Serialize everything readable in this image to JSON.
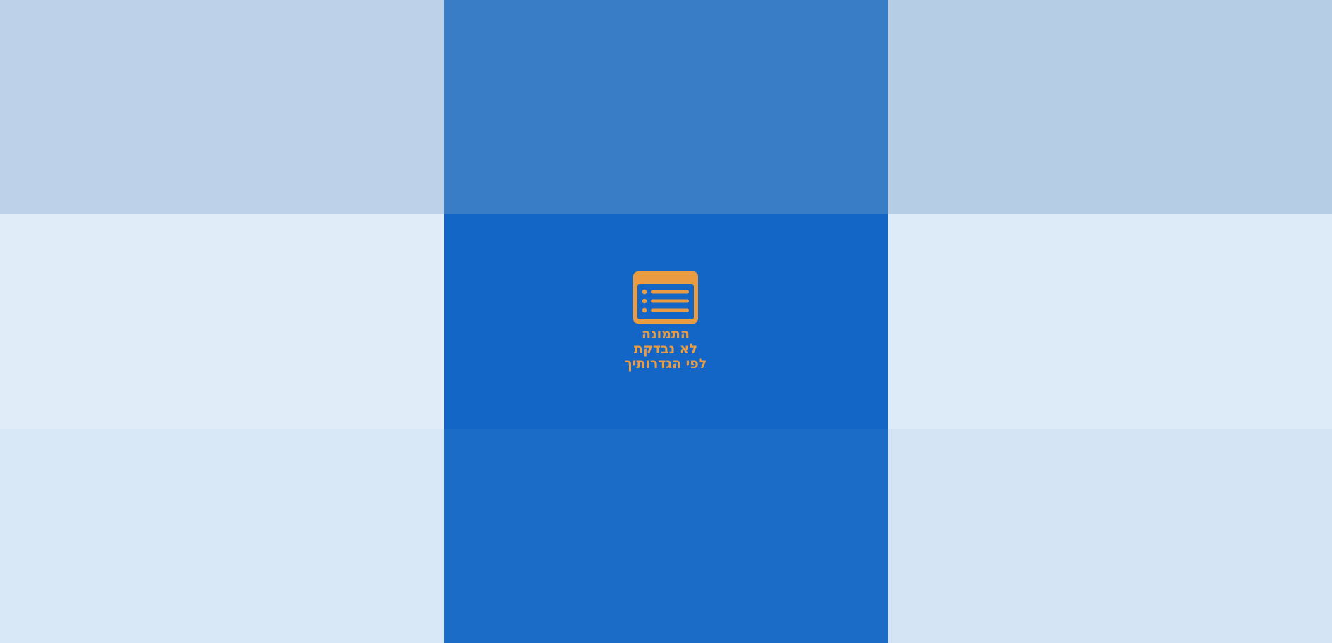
{
  "colors": {
    "tile_top_left": "#bdd1e9",
    "tile_top_center": "#387dc6",
    "tile_top_right": "#b6cde6",
    "tile_mid_left": "#e0ecf8",
    "tile_mid_center": "#1366c5",
    "tile_mid_right": "#ddeaf7",
    "tile_bottom_left": "#d9e8f6",
    "tile_bottom_center": "#1b6cc7",
    "tile_bottom_right": "#d5e4f4",
    "notice_accent": "#eb9c43"
  },
  "notice": {
    "icon": "image-blocked-list-icon",
    "lines": [
      "התמונה",
      "לא נבדקת",
      "לפי הגדרותיך"
    ]
  }
}
